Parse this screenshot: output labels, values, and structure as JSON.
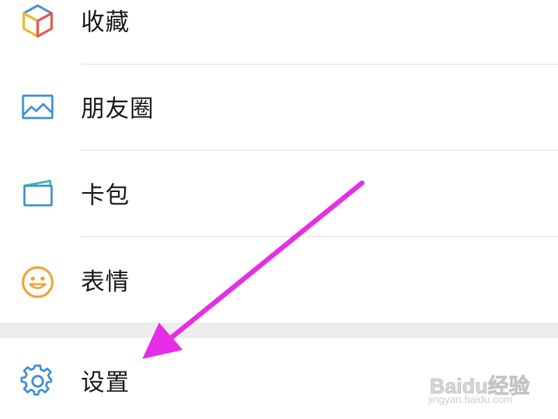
{
  "menu": {
    "items": [
      {
        "label": "收藏",
        "icon": "favorites-cube-icon"
      },
      {
        "label": "朋友圈",
        "icon": "moments-picture-icon"
      },
      {
        "label": "卡包",
        "icon": "card-wallet-icon"
      },
      {
        "label": "表情",
        "icon": "smiley-face-icon"
      }
    ]
  },
  "settings": {
    "label": "设置",
    "icon": "gear-icon"
  },
  "annotation": {
    "arrow_color": "#e52ee5"
  },
  "watermark": {
    "brand": "Baidu经验",
    "url": "jingyan.baidu.com"
  },
  "colors": {
    "background": "#ffffff",
    "divider": "#ececec",
    "section_gap": "#ededed",
    "label_text": "#1a1a1a"
  }
}
